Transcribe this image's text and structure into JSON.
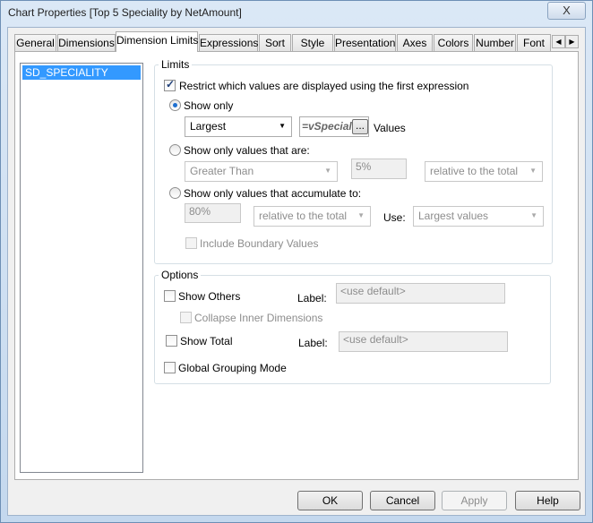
{
  "window": {
    "title": "Chart Properties [Top 5 Speciality by NetAmount]",
    "close": "X"
  },
  "tabs": [
    "General",
    "Dimensions",
    "Dimension Limits",
    "Expressions",
    "Sort",
    "Style",
    "Presentation",
    "Axes",
    "Colors",
    "Number",
    "Font"
  ],
  "active_tab": "Dimension Limits",
  "dimensions": [
    "SD_SPECIALITY"
  ],
  "limits": {
    "legend": "Limits",
    "restrict_label": "Restrict which values are displayed using the first expression",
    "restrict_checked": true,
    "show_only_label": "Show only",
    "show_only_selected": true,
    "show_only_mode": "Largest",
    "show_only_expr": "=vSpecial",
    "expr_button": "...",
    "values_label": "Values",
    "values_that_are_label": "Show only values that are:",
    "comparison": "Greater Than",
    "comparison_value": "5%",
    "comparison_relative": "relative to the total",
    "accumulate_label": "Show only values that accumulate to:",
    "accumulate_value": "80%",
    "accumulate_relative": "relative to the total",
    "use_label": "Use:",
    "use_value": "Largest values",
    "include_boundary_label": "Include Boundary Values"
  },
  "options": {
    "legend": "Options",
    "show_others_label": "Show Others",
    "label1": "Label:",
    "others_placeholder": "<use default>",
    "collapse_label": "Collapse Inner Dimensions",
    "show_total_label": "Show Total",
    "label2": "Label:",
    "total_placeholder": "<use default>",
    "global_grouping_label": "Global Grouping Mode"
  },
  "buttons": {
    "ok": "OK",
    "cancel": "Cancel",
    "apply": "Apply",
    "help": "Help"
  }
}
